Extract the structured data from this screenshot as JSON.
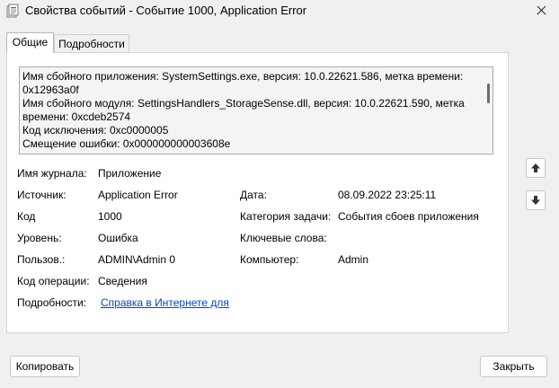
{
  "window": {
    "title": "Свойства событий - Событие 1000, Application Error"
  },
  "tabs": [
    {
      "label": "Общие",
      "active": true
    },
    {
      "label": "Подробности",
      "active": false
    }
  ],
  "description": {
    "text": "Имя сбойного приложения: SystemSettings.exe, версия: 10.0.22621.586, метка времени: 0x12963a0f\nИмя сбойного модуля: SettingsHandlers_StorageSense.dll, версия: 10.0.22621.590, метка времени: 0xcdeb2574\nКод исключения: 0xc0000005\nСмещение ошибки: 0x000000000003608e"
  },
  "fields": {
    "log_name": {
      "label": "Имя журнала:",
      "value": "Приложение"
    },
    "source": {
      "label": "Источник:",
      "value": "Application Error"
    },
    "date": {
      "label": "Дата:",
      "value": "08.09.2022 23:25:11"
    },
    "event_id": {
      "label": "Код",
      "value": "1000"
    },
    "task_category": {
      "label": "Категория задачи:",
      "value": "События сбоев приложения"
    },
    "level": {
      "label": "Уровень:",
      "value": "Ошибка"
    },
    "keywords": {
      "label": "Ключевые слова:",
      "value": ""
    },
    "user": {
      "label": "Пользов.:",
      "value": "ADMIN\\Admin 0"
    },
    "computer": {
      "label": "Компьютер:",
      "value": "Admin"
    },
    "opcode": {
      "label": "Код операции:",
      "value": "Сведения"
    },
    "more_info": {
      "label": "Подробности:",
      "value": "Справка в Интернете для "
    }
  },
  "buttons": {
    "copy": "Копировать",
    "close": "Закрыть"
  },
  "icons": {
    "app": "event-viewer-icon",
    "up": "arrow-up-icon",
    "down": "arrow-down-icon",
    "close": "close-icon"
  },
  "colors": {
    "link": "#0047c4",
    "background": "#f0f0f0"
  }
}
